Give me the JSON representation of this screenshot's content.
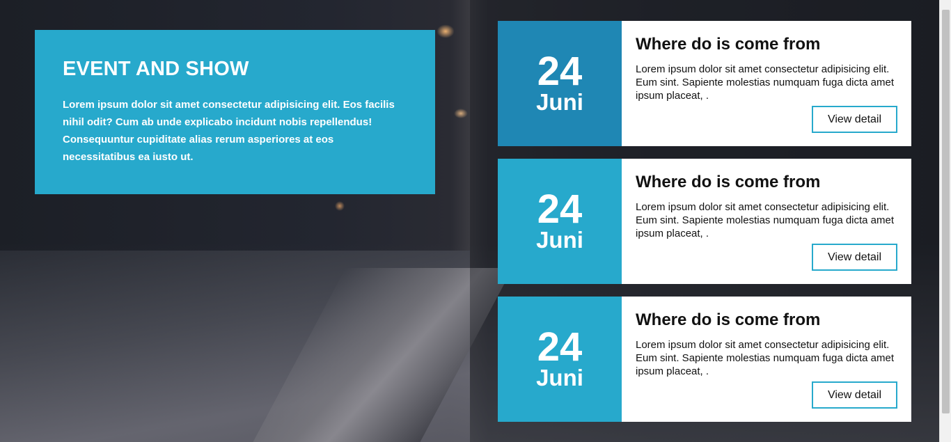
{
  "intro": {
    "title": "EVENT AND SHOW",
    "text": "Lorem ipsum dolor sit amet consectetur adipisicing elit. Eos facilis nihil odit? Cum ab unde explicabo incidunt nobis repellendus! Consequuntur cupiditate alias rerum asperiores at eos necessitatibus ea iusto ut."
  },
  "events": [
    {
      "day": "24",
      "month": "Juni",
      "title": "Where do is come from",
      "text": "Lorem ipsum dolor sit amet consectetur adipisicing elit. Eum sint. Sapiente molestias numquam fuga dicta amet ipsum placeat, .",
      "button": "View detail"
    },
    {
      "day": "24",
      "month": "Juni",
      "title": "Where do is come from",
      "text": "Lorem ipsum dolor sit amet consectetur adipisicing elit. Eum sint. Sapiente molestias numquam fuga dicta amet ipsum placeat, .",
      "button": "View detail"
    },
    {
      "day": "24",
      "month": "Juni",
      "title": "Where do is come from",
      "text": "Lorem ipsum dolor sit amet consectetur adipisicing elit. Eum sint. Sapiente molestias numquam fuga dicta amet ipsum placeat, .",
      "button": "View detail"
    }
  ],
  "colors": {
    "accent": "#27a9cc",
    "accent_dark": "#1f87b4"
  }
}
